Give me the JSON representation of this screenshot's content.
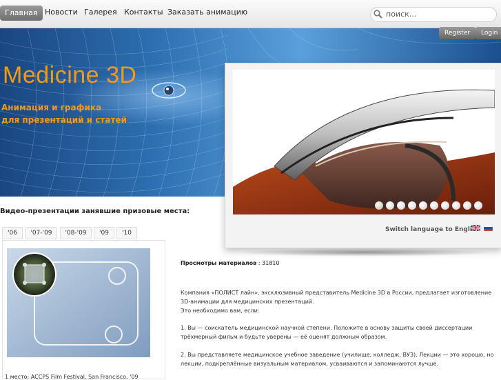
{
  "nav": {
    "items": [
      "Главная",
      "Новости",
      "Галерея",
      "Контакты",
      "Заказать анимацию"
    ],
    "search_placeholder": "поиск..."
  },
  "header": {
    "brand": "Medicine 3D",
    "tagline_line1": "Анимация и графика",
    "tagline_line2": "для презентаций и статей",
    "register_label": "Register",
    "login_label": "Login"
  },
  "slider": {
    "dot_count": 10,
    "active_dot": 0,
    "switch_language_label": "Switch language to English",
    "flags": [
      "uk-flag-icon",
      "ru-flag-icon"
    ]
  },
  "videos": {
    "section_title": "Видео-презентации занявшие призовые места:",
    "year_tabs": [
      "'06",
      "'07-'09",
      "'08-'09",
      "'09",
      "'10"
    ],
    "caption": "1 место: ACCPS Film Festival, San Francisco, '09"
  },
  "content": {
    "stats_label": "Просмотры материалов",
    "stats_value": ": 31810",
    "paragraphs": [
      "Компания «ПОЛИСТ лайн», эксклюзивный представитель Medicine 3D в России, предлагает изготовление",
      "3D-анимации для медицинских презентаций.",
      "Это необходимо вам, если:",
      "1. Вы — соискатель медицинской научной степени. Положите в основу защиты своей диссертации",
      "трёхмерный фильм и будьте уверены — её оценят должным образом.",
      "2. Вы представляете медицинское учебное заведение (училище, колледж, ВУЗ). Лекции — это хорошо, но",
      "лекции, подкреплённые визуальным материалом, усваиваются и запоминаются лучше."
    ]
  },
  "colors": {
    "accent_orange": "#f39a14",
    "hero_blue": "#2c6eb0",
    "nav_active": "#7d7d7d"
  }
}
